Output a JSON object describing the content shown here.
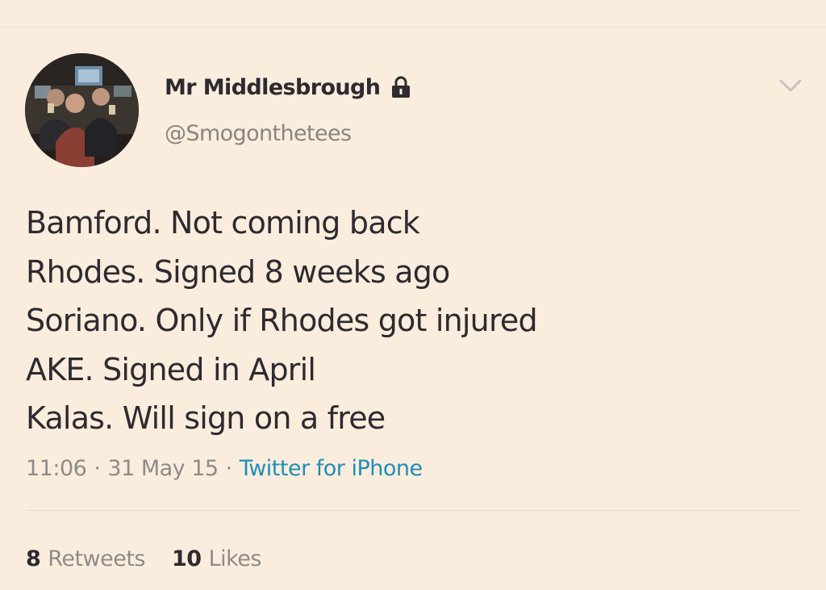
{
  "tweet": {
    "author": {
      "display_name": "Mr Middlesbrough",
      "handle": "@Smogonthetees",
      "avatar_icon": "group-photo-avatar",
      "protected_icon": "lock-icon"
    },
    "menu_icon": "chevron-down-icon",
    "lines": [
      "Bamford. Not coming back",
      "Rhodes. Signed 8 weeks ago",
      "Soriano. Only if Rhodes got injured",
      "AKE. Signed in April",
      "Kalas. Will sign on a free"
    ],
    "meta": {
      "time": "11:06",
      "separator": "·",
      "date": "31 May 15",
      "source": "Twitter for iPhone"
    },
    "stats": {
      "retweets_count": "8",
      "retweets_label": "Retweets",
      "likes_count": "10",
      "likes_label": "Likes"
    }
  },
  "colors": {
    "background": "#fbeddd",
    "text": "#2d2a30",
    "muted": "#8e8b87",
    "link": "#1d8fb8"
  }
}
